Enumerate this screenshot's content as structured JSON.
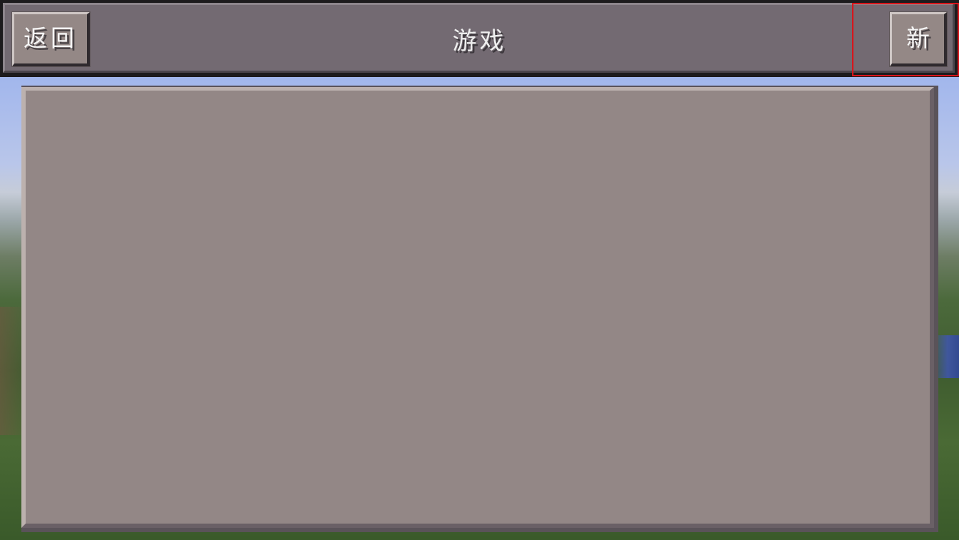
{
  "screen": {
    "title": "游戏"
  },
  "toolbar": {
    "back_label": "返回",
    "new_label": "新"
  },
  "world_list": {
    "items": []
  },
  "colors": {
    "bar": "#736a72",
    "button": "#948886",
    "panel": "#938786",
    "highlight": "#d8151b",
    "text": "#f5f5f5"
  }
}
